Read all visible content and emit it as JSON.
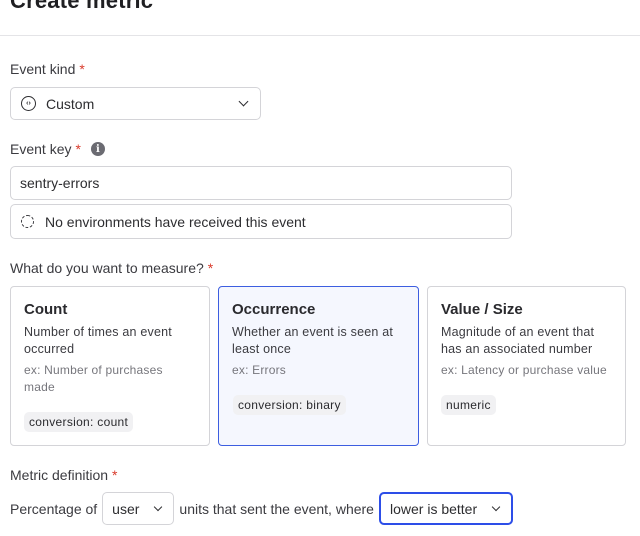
{
  "page": {
    "title": "Create metric"
  },
  "event_kind": {
    "label": "Event kind",
    "required_mark": "*",
    "selected": "Custom",
    "icon": "code-circle-icon"
  },
  "event_key": {
    "label": "Event key",
    "required_mark": "*",
    "info_icon": "i",
    "value": "sentry-errors",
    "environment_status": "No environments have received this event"
  },
  "measure": {
    "label": "What do you want to measure?",
    "required_mark": "*",
    "options": [
      {
        "title": "Count",
        "description": "Number of times an event occurred",
        "example": "ex: Number of purchases made",
        "tag": "conversion: count",
        "selected": false
      },
      {
        "title": "Occurrence",
        "description": "Whether an event is seen at least once",
        "example": "ex: Errors",
        "tag": "conversion: binary",
        "selected": true
      },
      {
        "title": "Value / Size",
        "description": "Magnitude of an event that has an associated number",
        "example": "ex: Latency or purchase value",
        "tag": "numeric",
        "selected": false
      }
    ]
  },
  "metric_definition": {
    "label": "Metric definition",
    "required_mark": "*",
    "prefix": "Percentage of",
    "unit": "user",
    "middle": "units that sent the event, where",
    "direction": "lower is better"
  },
  "colors": {
    "accent": "#3d5ee0",
    "required": "#d93a2b",
    "selected_card_bg": "#f5f7fe"
  }
}
